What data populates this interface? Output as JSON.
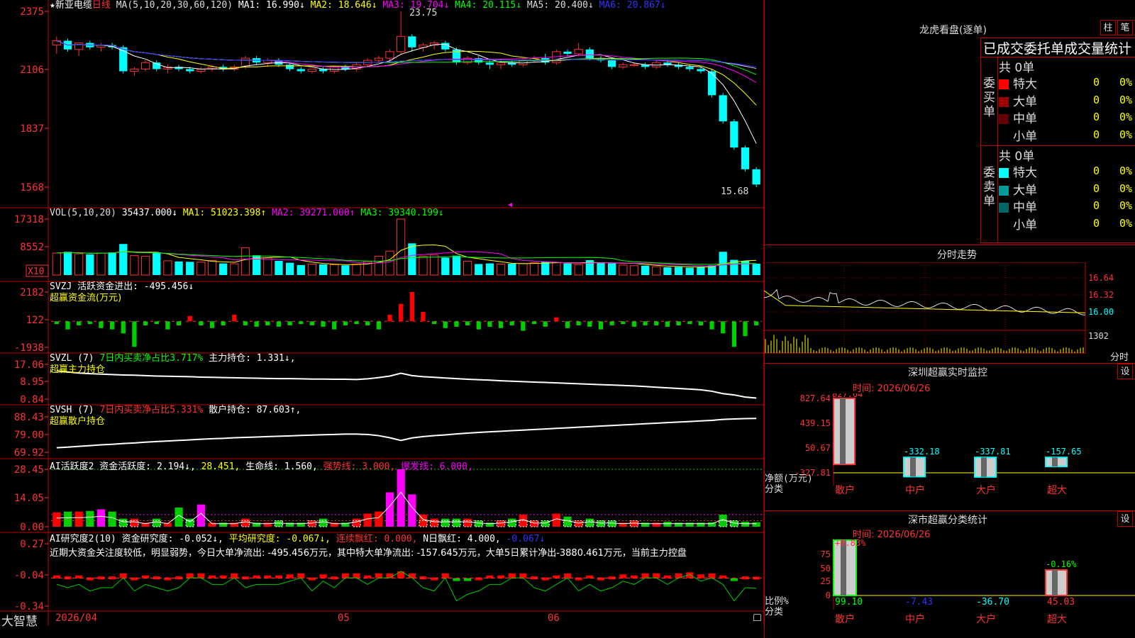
{
  "stock": {
    "star": "★",
    "name": "新亚电缆",
    "period": "日线"
  },
  "ma_header": {
    "label": "MA(5,10,20,30,60,120)",
    "items": [
      {
        "text": "MA1: 16.990↓",
        "color": "#ffffff"
      },
      {
        "text": "MA2: 18.646↓",
        "color": "#ffff00"
      },
      {
        "text": "MA3: 19.704↓",
        "color": "#ff00ff"
      },
      {
        "text": "MA4: 20.115↓",
        "color": "#00ff00"
      },
      {
        "text": "MA5: 20.400↓",
        "color": "#dddddd"
      },
      {
        "text": "MA6: 20.867↓",
        "color": "#3333ff"
      }
    ]
  },
  "price_axis": [
    "2375",
    "2106",
    "1837",
    "1568"
  ],
  "high_label": "23.75",
  "low_label": "15.68",
  "vol_header": {
    "label": "VOL(5,10,20)",
    "value": "35437.000↓",
    "ma1": "MA1: 51023.398↑",
    "ma2": "MA2: 39271.000↑",
    "ma3": "MA3: 39340.199↓"
  },
  "vol_axis": [
    "17318",
    "8552"
  ],
  "vol_unit": "X10",
  "svzj": {
    "label": "SVZJ  活跃资金进出: -495.456↓",
    "sub": "超赢资金流(万元)",
    "axis": [
      "2182",
      "122",
      "-1938"
    ]
  },
  "svzl": {
    "label": "SVZL (7) ",
    "part2": "7日内买卖净占比3.717%",
    "part3": " 主力持仓: 1.331↓,",
    "sub": "超赢主力持仓",
    "axis": [
      "17.06",
      "8.95",
      "0.84"
    ]
  },
  "svsh": {
    "label": "SVSH (7) ",
    "part2": "7日内买卖净占比5.331%",
    "part3": " 散户持仓: 87.603↑,",
    "sub": "超赢散户持仓",
    "axis": [
      "88.43",
      "79.00",
      "69.92"
    ]
  },
  "ai_act": {
    "label": "AI活跃度2 资金活跃度: 2.194↓,",
    "v2": "28.451,",
    "v3": "生命线: 1.560,",
    "v4": "强势线: 3.000,",
    "v5": "爆发线: 6.000,",
    "axis": [
      "28.45",
      "14.05",
      "0.00"
    ]
  },
  "ai_res": {
    "label": "AI研究度2(10) 资金研究度: -0.052↓,",
    "v2": "平均研究度: -0.067↓,",
    "v3": "连续飘红: 0.000,",
    "v4": "N日飘红: 4.000,",
    "v5": "-0.067↓",
    "axis": [
      "0.27",
      "-0.04",
      "-0.34"
    ],
    "comment": "近期大资金关注度较低，明显弱势，今日大单净流出: -495.456万元，其中特大单净流出: -157.645万元，大单5日累计净出-3880.461万元，当前主力控盘"
  },
  "date_axis": {
    "d1": "2026/04",
    "d2": "05",
    "d3": "06"
  },
  "brand": "大智慧",
  "lhb": {
    "title": "龙虎看盘(逐单)",
    "btn1": "柱",
    "btn2": "笔",
    "heading": "已成交委托单成交量统计",
    "buy": {
      "label": "委买单",
      "total": "共 0单",
      "rows": [
        {
          "name": "特大",
          "v": "0",
          "p": "0%",
          "color": "#ff0000"
        },
        {
          "name": "大单",
          "v": "0",
          "p": "0%",
          "color": "#990000"
        },
        {
          "name": "中单",
          "v": "0",
          "p": "0%",
          "color": "#660000"
        },
        {
          "name": "小单",
          "v": "0",
          "p": "0%",
          "color": "#000000"
        }
      ]
    },
    "sell": {
      "label": "委卖单",
      "total": "共 0单",
      "rows": [
        {
          "name": "特大",
          "v": "0",
          "p": "0%",
          "color": "#00ffff"
        },
        {
          "name": "大单",
          "v": "0",
          "p": "0%",
          "color": "#009999"
        },
        {
          "name": "中单",
          "v": "0",
          "p": "0%",
          "color": "#006666"
        },
        {
          "name": "小单",
          "v": "0",
          "p": "0%",
          "color": "#000000"
        }
      ]
    }
  },
  "fenshi": {
    "title": "分时走势",
    "axis": [
      "16.64",
      "16.32",
      "16.00",
      "1302"
    ],
    "unit": "分时"
  },
  "sz_monitor": {
    "title": "深圳超赢实时监控",
    "btn": "设",
    "time": "时间: 2026/06/26",
    "axis": [
      "827.64",
      "439.15",
      "50.67",
      "-327.81"
    ],
    "bar_labels": [
      "827.64",
      "-332.18",
      "-337.81",
      "-157.65"
    ],
    "cats": [
      "散户",
      "中户",
      "大户",
      "超大"
    ],
    "ylab1": "净额(万元)",
    "ylab2": "分类"
  },
  "sz_class": {
    "title": "深市超赢分类统计",
    "btn": "设",
    "time": "时间: 2026/06/26",
    "axis": [
      "75",
      "50",
      "25",
      "0"
    ],
    "top_labels": [
      "+0.83%",
      "-0.16%"
    ],
    "bottom": [
      "99.10",
      "-7.43",
      "-36.70",
      "45.03"
    ],
    "cats": [
      "散户",
      "中户",
      "大户",
      "超大"
    ],
    "ylab1": "比例%",
    "ylab2": "分类"
  },
  "chart_data": {
    "type": "candlestick",
    "candles": [
      [
        22.2,
        22.6,
        21.8,
        22.4
      ],
      [
        22.4,
        22.5,
        21.9,
        22.0
      ],
      [
        22.0,
        22.3,
        21.7,
        22.3
      ],
      [
        22.3,
        22.4,
        22.0,
        22.1
      ],
      [
        22.1,
        22.3,
        21.9,
        22.2
      ],
      [
        22.2,
        22.3,
        22.0,
        22.1
      ],
      [
        22.1,
        22.2,
        20.9,
        21.0
      ],
      [
        21.0,
        21.2,
        20.8,
        21.1
      ],
      [
        21.1,
        21.5,
        21.0,
        21.4
      ],
      [
        21.4,
        21.5,
        21.0,
        21.1
      ],
      [
        21.1,
        21.3,
        20.9,
        21.2
      ],
      [
        21.2,
        21.3,
        21.0,
        21.1
      ],
      [
        21.1,
        21.2,
        20.9,
        21.0
      ],
      [
        21.0,
        21.2,
        20.9,
        21.1
      ],
      [
        21.1,
        21.3,
        21.0,
        21.2
      ],
      [
        21.2,
        21.3,
        21.0,
        21.1
      ],
      [
        21.1,
        21.3,
        21.0,
        21.2
      ],
      [
        21.2,
        21.7,
        21.1,
        21.6
      ],
      [
        21.6,
        21.7,
        21.3,
        21.4
      ],
      [
        21.4,
        21.6,
        21.2,
        21.5
      ],
      [
        21.5,
        21.6,
        21.2,
        21.3
      ],
      [
        21.3,
        21.4,
        21.0,
        21.1
      ],
      [
        21.1,
        21.2,
        20.9,
        21.0
      ],
      [
        21.0,
        21.1,
        20.9,
        21.1
      ],
      [
        21.1,
        21.2,
        20.9,
        21.0
      ],
      [
        21.0,
        21.2,
        20.9,
        21.2
      ],
      [
        21.2,
        21.3,
        21.0,
        21.1
      ],
      [
        21.1,
        21.4,
        21.0,
        21.3
      ],
      [
        21.3,
        21.6,
        21.2,
        21.5
      ],
      [
        21.5,
        21.7,
        21.4,
        21.6
      ],
      [
        21.6,
        22.0,
        21.4,
        21.9
      ],
      [
        21.9,
        23.75,
        21.8,
        22.6
      ],
      [
        22.6,
        22.7,
        21.9,
        22.1
      ],
      [
        22.1,
        22.3,
        21.9,
        22.2
      ],
      [
        22.2,
        22.4,
        22.0,
        22.3
      ],
      [
        22.3,
        22.4,
        21.9,
        22.0
      ],
      [
        22.0,
        22.1,
        21.3,
        21.4
      ],
      [
        21.4,
        21.7,
        21.3,
        21.6
      ],
      [
        21.6,
        21.7,
        21.3,
        21.4
      ],
      [
        21.4,
        21.5,
        21.1,
        21.3
      ],
      [
        21.3,
        21.5,
        21.1,
        21.4
      ],
      [
        21.4,
        21.5,
        21.2,
        21.3
      ],
      [
        21.3,
        21.6,
        21.2,
        21.5
      ],
      [
        21.5,
        21.7,
        21.4,
        21.6
      ],
      [
        21.6,
        21.8,
        21.3,
        21.4
      ],
      [
        21.4,
        22.0,
        21.3,
        21.9
      ],
      [
        21.9,
        22.0,
        21.7,
        21.8
      ],
      [
        21.8,
        22.3,
        21.7,
        22.0
      ],
      [
        22.0,
        22.1,
        21.5,
        21.6
      ],
      [
        21.6,
        21.7,
        21.4,
        21.5
      ],
      [
        21.5,
        21.6,
        21.1,
        21.2
      ],
      [
        21.2,
        21.4,
        21.1,
        21.3
      ],
      [
        21.3,
        21.4,
        21.2,
        21.3
      ],
      [
        21.3,
        21.4,
        21.1,
        21.2
      ],
      [
        21.2,
        21.5,
        21.1,
        21.4
      ],
      [
        21.4,
        21.5,
        21.2,
        21.3
      ],
      [
        21.3,
        21.4,
        21.1,
        21.2
      ],
      [
        21.2,
        21.3,
        21.0,
        21.1
      ],
      [
        21.1,
        21.2,
        20.9,
        21.0
      ],
      [
        21.0,
        21.1,
        19.8,
        19.9
      ],
      [
        19.9,
        20.0,
        18.6,
        18.7
      ],
      [
        18.7,
        18.8,
        17.4,
        17.5
      ],
      [
        17.5,
        17.6,
        16.4,
        16.5
      ],
      [
        16.5,
        16.6,
        15.68,
        15.8
      ]
    ],
    "volume": [
      6800,
      7200,
      6600,
      6400,
      6800,
      7000,
      9600,
      6000,
      5800,
      6900,
      4400,
      4200,
      4100,
      4000,
      4500,
      3600,
      3500,
      8400,
      6100,
      5300,
      4400,
      3800,
      3100,
      3400,
      3300,
      3200,
      3000,
      3400,
      4200,
      5800,
      7400,
      17318,
      9800,
      5800,
      6200,
      5400,
      6000,
      4300,
      3400,
      3600,
      3400,
      3500,
      3600,
      3800,
      4200,
      3900,
      3600,
      3200,
      4600,
      3900,
      3600,
      3100,
      2900,
      2900,
      2600,
      2400,
      2500,
      2300,
      2600,
      3000,
      7200,
      4700,
      4400,
      3500
    ],
    "svzj": [
      -200,
      -600,
      -300,
      -200,
      -500,
      -600,
      -900,
      -1900,
      -300,
      -200,
      -600,
      -300,
      400,
      -300,
      -500,
      -300,
      500,
      -300,
      -400,
      -300,
      -400,
      -300,
      -200,
      -300,
      -400,
      -600,
      -300,
      -200,
      -300,
      -600,
      500,
      1300,
      2182,
      700,
      -200,
      -500,
      -400,
      -300,
      -600,
      -400,
      -500,
      -300,
      -700,
      -200,
      -400,
      300,
      -500,
      -300,
      -400,
      -600,
      -300,
      -200,
      -400,
      -300,
      -300,
      -400,
      -300,
      -200,
      -300,
      -600,
      -900,
      -1900,
      -1100,
      -300
    ],
    "main_hold": [
      14.0,
      13.5,
      13.0,
      12.7,
      12.5,
      12.3,
      12.1,
      12.0,
      11.8,
      11.6,
      11.5,
      11.4,
      11.3,
      11.1,
      11.0,
      10.9,
      10.8,
      10.7,
      10.6,
      10.5,
      10.4,
      10.4,
      10.3,
      10.2,
      10.2,
      10.1,
      10.1,
      10.0,
      10.3,
      10.9,
      11.6,
      12.9,
      11.8,
      11.3,
      11.0,
      10.7,
      10.4,
      10.1,
      9.9,
      9.7,
      9.4,
      9.2,
      9.0,
      8.8,
      8.6,
      8.4,
      8.2,
      8.0,
      7.8,
      7.6,
      7.4,
      7.2,
      7.0,
      6.7,
      6.4,
      6.1,
      5.8,
      5.5,
      5.2,
      4.5,
      3.4,
      2.8,
      1.8,
      1.331
    ],
    "retail_hold": [
      72.3,
      72.6,
      73.0,
      73.4,
      73.8,
      74.1,
      74.5,
      74.8,
      75.2,
      75.5,
      75.8,
      76.1,
      76.4,
      76.7,
      77.0,
      77.2,
      77.5,
      77.7,
      77.9,
      78.1,
      78.3,
      78.5,
      78.7,
      78.9,
      79.1,
      79.2,
      79.4,
      79.4,
      79.2,
      78.6,
      77.5,
      76.1,
      77.4,
      78.1,
      78.6,
      79.0,
      79.5,
      79.9,
      80.3,
      80.6,
      80.9,
      81.2,
      81.5,
      81.8,
      82.1,
      82.4,
      82.7,
      83.0,
      83.3,
      83.6,
      83.9,
      84.2,
      84.5,
      84.8,
      85.1,
      85.4,
      85.7,
      86.0,
      86.3,
      86.6,
      87.1,
      87.3,
      87.5,
      87.603
    ],
    "activity": [
      7.1,
      7.5,
      7.5,
      7.8,
      8.6,
      7.5,
      4.0,
      4.0,
      2.0,
      4.0,
      2.0,
      9.5,
      4.0,
      11.0,
      2.0,
      2.0,
      2.0,
      4.0,
      2.0,
      2.0,
      3.0,
      2.0,
      2.0,
      3.0,
      4.0,
      2.0,
      2.0,
      4.0,
      6.5,
      7.5,
      17.0,
      28.45,
      16.0,
      6.0,
      4.0,
      4.0,
      4.0,
      4.0,
      3.0,
      2.0,
      3.0,
      4.0,
      6.0,
      3.0,
      3.0,
      6.5,
      5.0,
      3.0,
      4.0,
      3.0,
      3.0,
      2.0,
      3.0,
      2.0,
      2.0,
      2.5,
      2.0,
      2.0,
      2.0,
      2.2,
      6.0,
      3.0,
      2.5,
      2.194
    ],
    "research": [
      -0.04,
      -0.05,
      -0.04,
      -0.06,
      -0.05,
      -0.05,
      -0.02,
      -0.06,
      -0.04,
      -0.05,
      -0.06,
      -0.05,
      -0.02,
      -0.02,
      -0.04,
      -0.04,
      -0.02,
      -0.05,
      -0.04,
      -0.04,
      -0.04,
      -0.03,
      -0.02,
      -0.06,
      -0.03,
      -0.05,
      -0.02,
      -0.02,
      -0.04,
      -0.02,
      -0.02,
      0.0,
      -0.02,
      -0.05,
      -0.06,
      -0.02,
      -0.09,
      -0.07,
      -0.06,
      -0.04,
      -0.04,
      -0.02,
      -0.02,
      -0.05,
      -0.06,
      -0.04,
      -0.02,
      -0.06,
      -0.04,
      -0.06,
      -0.05,
      -0.03,
      -0.04,
      -0.02,
      -0.02,
      -0.04,
      -0.02,
      -0.01,
      -0.03,
      -0.02,
      -0.04,
      -0.09,
      -0.05,
      -0.052
    ]
  }
}
